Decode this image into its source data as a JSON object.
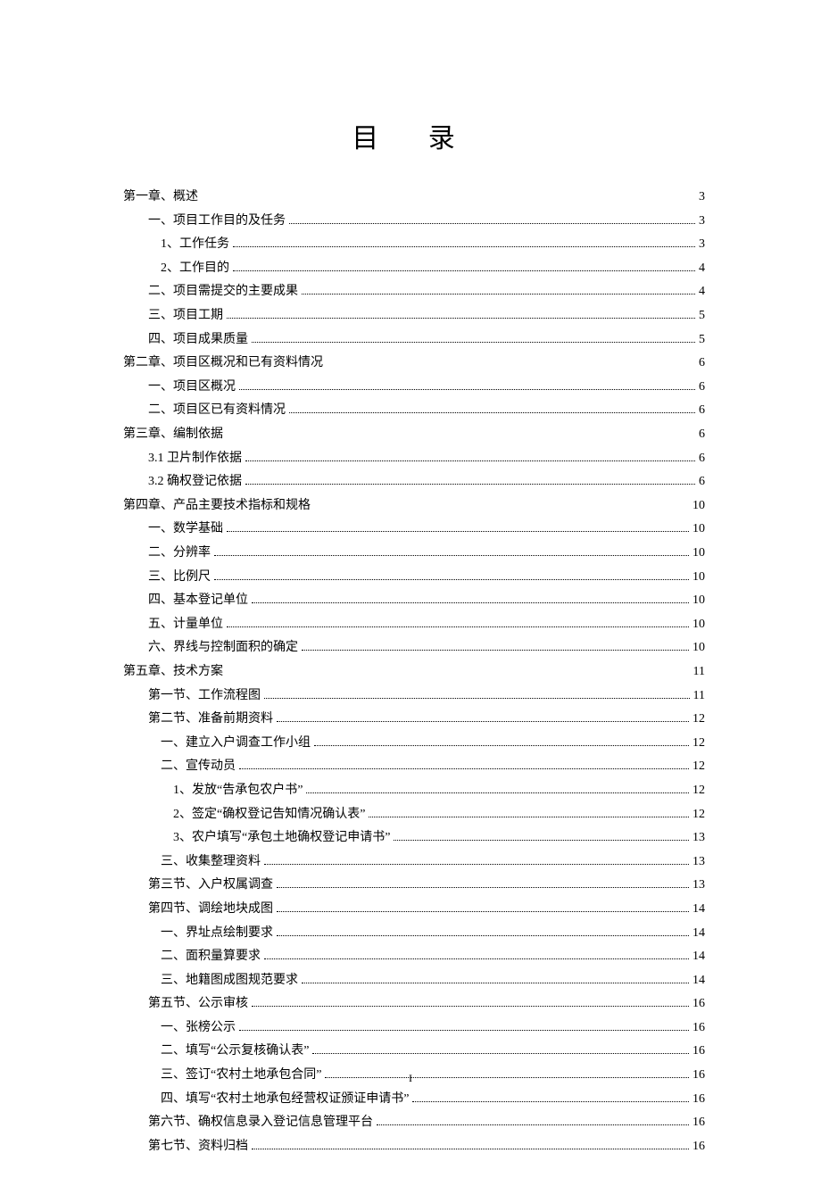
{
  "title": "目 录",
  "footer": "I",
  "entries": [
    {
      "label": "第一章、概述",
      "page": "3",
      "indent": 0,
      "sparse": true
    },
    {
      "label": "一、项目工作目的及任务",
      "page": "3",
      "indent": 1
    },
    {
      "label": "1、工作任务",
      "page": "3",
      "indent": 2
    },
    {
      "label": "2、工作目的",
      "page": "4",
      "indent": 2
    },
    {
      "label": "二、项目需提交的主要成果",
      "page": "4",
      "indent": 1
    },
    {
      "label": "三、项目工期",
      "page": "5",
      "indent": 1
    },
    {
      "label": "四、项目成果质量",
      "page": "5",
      "indent": 1
    },
    {
      "label": "第二章、项目区概况和已有资料情况",
      "page": "6",
      "indent": 0,
      "sparse": true
    },
    {
      "label": "一、项目区概况",
      "page": "6",
      "indent": 1
    },
    {
      "label": "二、项目区已有资料情况",
      "page": "6",
      "indent": 1
    },
    {
      "label": "第三章、编制依据",
      "page": "6",
      "indent": 0,
      "sparse": true
    },
    {
      "label": "3.1 卫片制作依据",
      "page": "6",
      "indent": 1
    },
    {
      "label": "3.2 确权登记依据",
      "page": "6",
      "indent": 1
    },
    {
      "label": "第四章、产品主要技术指标和规格",
      "page": "10",
      "indent": 0,
      "sparse": true
    },
    {
      "label": "一、数学基础",
      "page": "10",
      "indent": 1
    },
    {
      "label": "二、分辨率",
      "page": "10",
      "indent": 1
    },
    {
      "label": "三、比例尺",
      "page": "10",
      "indent": 1
    },
    {
      "label": "四、基本登记单位",
      "page": "10",
      "indent": 1
    },
    {
      "label": "五、计量单位",
      "page": "10",
      "indent": 1
    },
    {
      "label": "六、界线与控制面积的确定",
      "page": "10",
      "indent": 1
    },
    {
      "label": "第五章、技术方案",
      "page": "11",
      "indent": 0,
      "sparse": true
    },
    {
      "label": "第一节、工作流程图",
      "page": "11",
      "indent": 1
    },
    {
      "label": "第二节、准备前期资料",
      "page": "12",
      "indent": 1
    },
    {
      "label": "一、建立入户调查工作小组",
      "page": "12",
      "indent": 2
    },
    {
      "label": "二、宣传动员",
      "page": "12",
      "indent": 2
    },
    {
      "label": "1、发放“告承包农户书”",
      "page": "12",
      "indent": 3
    },
    {
      "label": "2、签定“确权登记告知情况确认表”",
      "page": "12",
      "indent": 3
    },
    {
      "label": "3、农户填写“承包土地确权登记申请书”",
      "page": "13",
      "indent": 3
    },
    {
      "label": "三、收集整理资料",
      "page": "13",
      "indent": 2
    },
    {
      "label": "第三节、入户权属调查",
      "page": "13",
      "indent": 1
    },
    {
      "label": "第四节、调绘地块成图",
      "page": "14",
      "indent": 1
    },
    {
      "label": "一、界址点绘制要求",
      "page": "14",
      "indent": 2
    },
    {
      "label": "二、面积量算要求",
      "page": "14",
      "indent": 2
    },
    {
      "label": "三、地籍图成图规范要求",
      "page": "14",
      "indent": 2
    },
    {
      "label": "第五节、公示审核",
      "page": "16",
      "indent": 1
    },
    {
      "label": "一、张榜公示",
      "page": "16",
      "indent": 2
    },
    {
      "label": "二、填写“公示复核确认表”",
      "page": "16",
      "indent": 2
    },
    {
      "label": "三、签订“农村土地承包合同”",
      "page": "16",
      "indent": 2
    },
    {
      "label": "四、填写“农村土地承包经营权证颁证申请书”",
      "page": "16",
      "indent": 2
    },
    {
      "label": "第六节、确权信息录入登记信息管理平台",
      "page": "16",
      "indent": 1
    },
    {
      "label": "第七节、资料归档",
      "page": "16",
      "indent": 1
    }
  ]
}
